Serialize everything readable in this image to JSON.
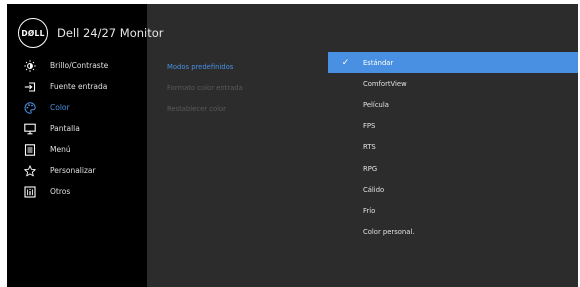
{
  "app": {
    "brand": "DØLL",
    "title": "Dell 24/27 Monitor"
  },
  "sidebar": {
    "items": [
      {
        "label": "Brillo/Contraste",
        "icon": "brightness-icon"
      },
      {
        "label": "Fuente entrada",
        "icon": "input-source-icon"
      },
      {
        "label": "Color",
        "icon": "palette-icon",
        "active": true
      },
      {
        "label": "Pantalla",
        "icon": "monitor-icon"
      },
      {
        "label": "Menú",
        "icon": "menu-icon"
      },
      {
        "label": "Personalizar",
        "icon": "star-icon"
      },
      {
        "label": "Otros",
        "icon": "info-icon"
      }
    ]
  },
  "color_menu": {
    "items": [
      {
        "label": "Modos predefinidos",
        "selected": true
      },
      {
        "label": "Formato color entrada"
      },
      {
        "label": "Restablecer color"
      }
    ]
  },
  "preset_modes": {
    "check_mark": "✓",
    "options": [
      {
        "label": "Estándar",
        "selected": true
      },
      {
        "label": "ComfortView"
      },
      {
        "label": "Película"
      },
      {
        "label": "FPS"
      },
      {
        "label": "RTS"
      },
      {
        "label": "RPG"
      },
      {
        "label": "Cálido"
      },
      {
        "label": "Frío"
      },
      {
        "label": "Color personal."
      }
    ]
  },
  "colors": {
    "accent": "#4a90e2",
    "sidebar_bg": "#000000",
    "panel_bg": "#2c2c2c"
  }
}
